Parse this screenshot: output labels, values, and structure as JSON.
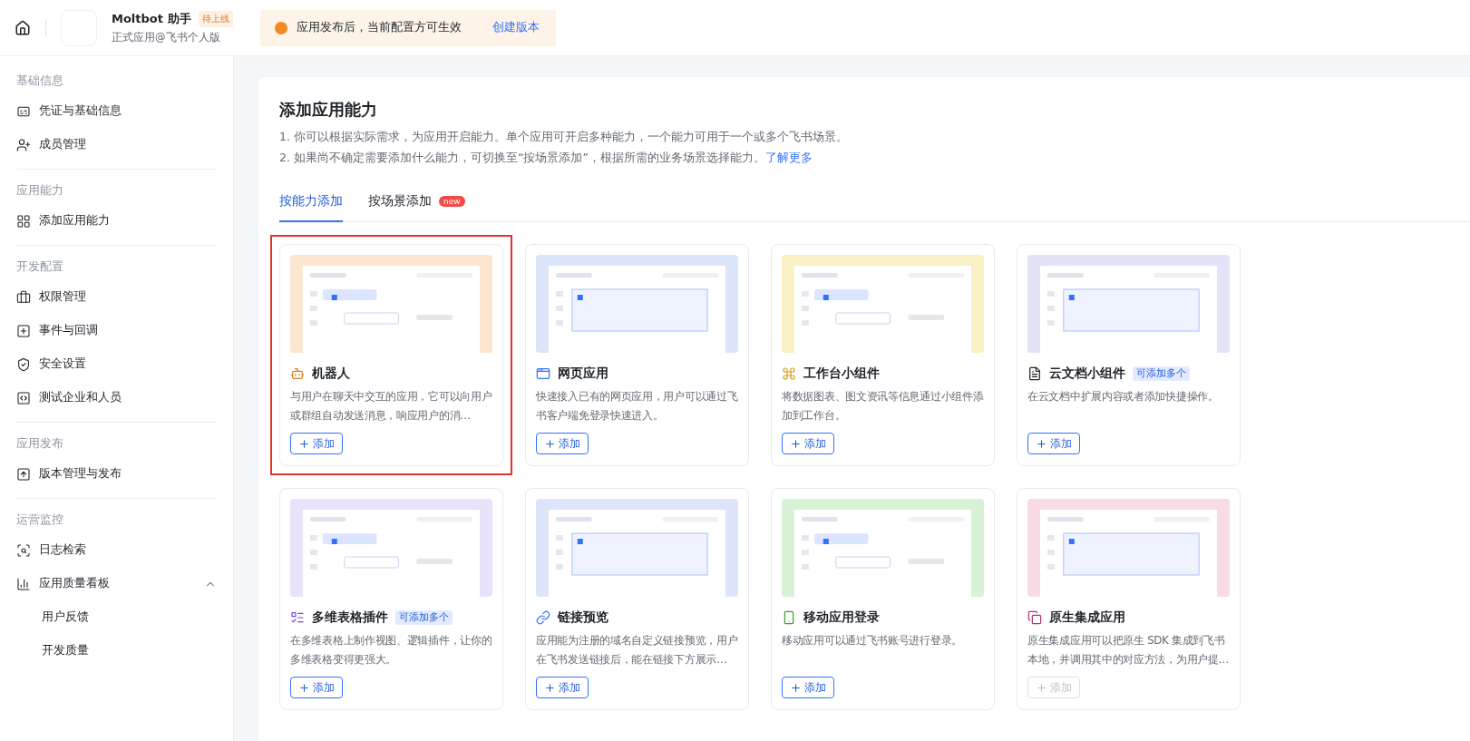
{
  "header": {
    "app_name": "Moltbot 助手",
    "status": "待上线",
    "subtitle": "正式应用@飞书个人版",
    "notice": "应用发布后，当前配置方可生效",
    "notice_link": "创建版本"
  },
  "sidebar": {
    "sections": [
      {
        "title": "基础信息",
        "items": [
          {
            "label": "凭证与基础信息"
          },
          {
            "label": "成员管理"
          }
        ]
      },
      {
        "title": "应用能力",
        "items": [
          {
            "label": "添加应用能力"
          }
        ]
      },
      {
        "title": "开发配置",
        "items": [
          {
            "label": "权限管理"
          },
          {
            "label": "事件与回调"
          },
          {
            "label": "安全设置"
          },
          {
            "label": "测试企业和人员"
          }
        ]
      },
      {
        "title": "应用发布",
        "items": [
          {
            "label": "版本管理与发布"
          }
        ]
      },
      {
        "title": "运营监控",
        "items": [
          {
            "label": "日志检索"
          },
          {
            "label": "应用质量看板",
            "expanded": true,
            "children": [
              {
                "label": "用户反馈"
              },
              {
                "label": "开发质量"
              }
            ]
          }
        ]
      }
    ]
  },
  "page": {
    "title": "添加应用能力",
    "notes": [
      "1. 你可以根据实际需求，为应用开启能力。单个应用可开启多种能力，一个能力可用于一个或多个飞书场景。",
      "2. 如果尚不确定需要添加什么能力，可切换至“按场景添加”，根据所需的业务场景选择能力。"
    ],
    "learn_more": "了解更多",
    "tabs": [
      {
        "label": "按能力添加",
        "selected": true
      },
      {
        "label": "按场景添加",
        "selected": false,
        "badge": "new"
      }
    ]
  },
  "cards": [
    {
      "title": "机器人",
      "description": "与用户在聊天中交互的应用，它可以向用户或群组自动发送消息，响应用户的消…",
      "add": "添加",
      "disabled": false,
      "highlighted": true,
      "color": "#fde6cf"
    },
    {
      "title": "网页应用",
      "description": "快速接入已有的网页应用，用户可以通过飞书客户端免登录快速进入。",
      "add": "添加",
      "disabled": false,
      "highlighted": false,
      "color": "#dde5fb"
    },
    {
      "title": "工作台小组件",
      "description": "将数据图表、图文资讯等信息通过小组件添加到工作台。",
      "add": "添加",
      "disabled": false,
      "highlighted": false,
      "color": "#faf0c6"
    },
    {
      "title": "云文档小组件",
      "badge": "可添加多个",
      "description": "在云文档中扩展内容或者添加快捷操作。",
      "add": "添加",
      "disabled": false,
      "highlighted": false,
      "color": "#e3e3f8"
    },
    {
      "title": "多维表格插件",
      "badge": "可添加多个",
      "description": "在多维表格上制作视图、逻辑插件，让你的多维表格变得更强大。",
      "add": "添加",
      "disabled": false,
      "highlighted": false,
      "color": "#ebe2fa"
    },
    {
      "title": "链接预览",
      "description": "应用能为注册的域名自定义链接预览，用户在飞书发送链接后，能在链接下方展示…",
      "add": "添加",
      "disabled": false,
      "highlighted": false,
      "color": "#dde5fb"
    },
    {
      "title": "移动应用登录",
      "description": "移动应用可以通过飞书账号进行登录。",
      "add": "添加",
      "disabled": false,
      "highlighted": false,
      "color": "#d8f2d6"
    },
    {
      "title": "原生集成应用",
      "description": "原生集成应用可以把原生 SDK 集成到飞书本地，并调用其中的对应方法，为用户提…",
      "add": "添加",
      "disabled": true,
      "highlighted": false,
      "color": "#f9dbe6"
    }
  ]
}
